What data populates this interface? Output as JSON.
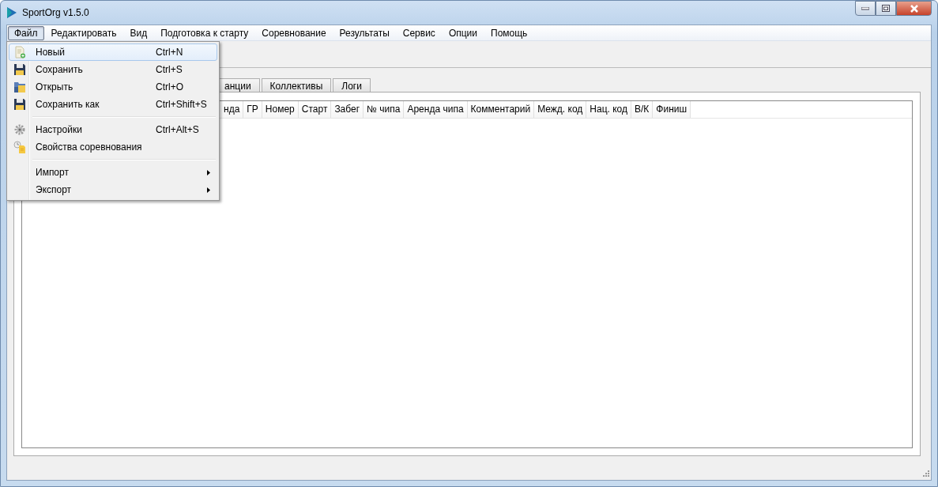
{
  "window": {
    "title": "SportOrg v1.5.0"
  },
  "menu_bar": [
    {
      "label": "Файл",
      "selected": true
    },
    {
      "label": "Редактировать",
      "selected": false
    },
    {
      "label": "Вид",
      "selected": false
    },
    {
      "label": "Подготовка к старту",
      "selected": false
    },
    {
      "label": "Соревнование",
      "selected": false
    },
    {
      "label": "Результаты",
      "selected": false
    },
    {
      "label": "Сервис",
      "selected": false
    },
    {
      "label": "Опции",
      "selected": false
    },
    {
      "label": "Помощь",
      "selected": false
    }
  ],
  "file_menu": [
    {
      "kind": "item",
      "label": "Новый",
      "shortcut": "Ctrl+N",
      "selected": true
    },
    {
      "kind": "item",
      "label": "Сохранить",
      "shortcut": "Ctrl+S",
      "selected": false
    },
    {
      "kind": "item",
      "label": "Открыть",
      "shortcut": "Ctrl+O",
      "selected": false
    },
    {
      "kind": "item",
      "label": "Сохранить как",
      "shortcut": "Ctrl+Shift+S",
      "selected": false
    },
    {
      "kind": "separator"
    },
    {
      "kind": "item",
      "label": "Настройки",
      "shortcut": "Ctrl+Alt+S",
      "selected": false
    },
    {
      "kind": "item",
      "label": "Свойства соревнования",
      "selected": false
    },
    {
      "kind": "separator"
    },
    {
      "kind": "submenu",
      "label": "Импорт",
      "selected": false
    },
    {
      "kind": "submenu",
      "label": "Экспорт",
      "selected": false
    }
  ],
  "tabs": [
    {
      "label": "анции"
    },
    {
      "label": "Коллективы"
    },
    {
      "label": "Логи"
    }
  ],
  "table": {
    "columns": [
      "нда",
      "ГР",
      "Номер",
      "Старт",
      "Забег",
      "№ чипа",
      "Аренда чипа",
      "Комментарий",
      "Межд. код",
      "Нац. код",
      "В/К",
      "Финиш"
    ]
  }
}
